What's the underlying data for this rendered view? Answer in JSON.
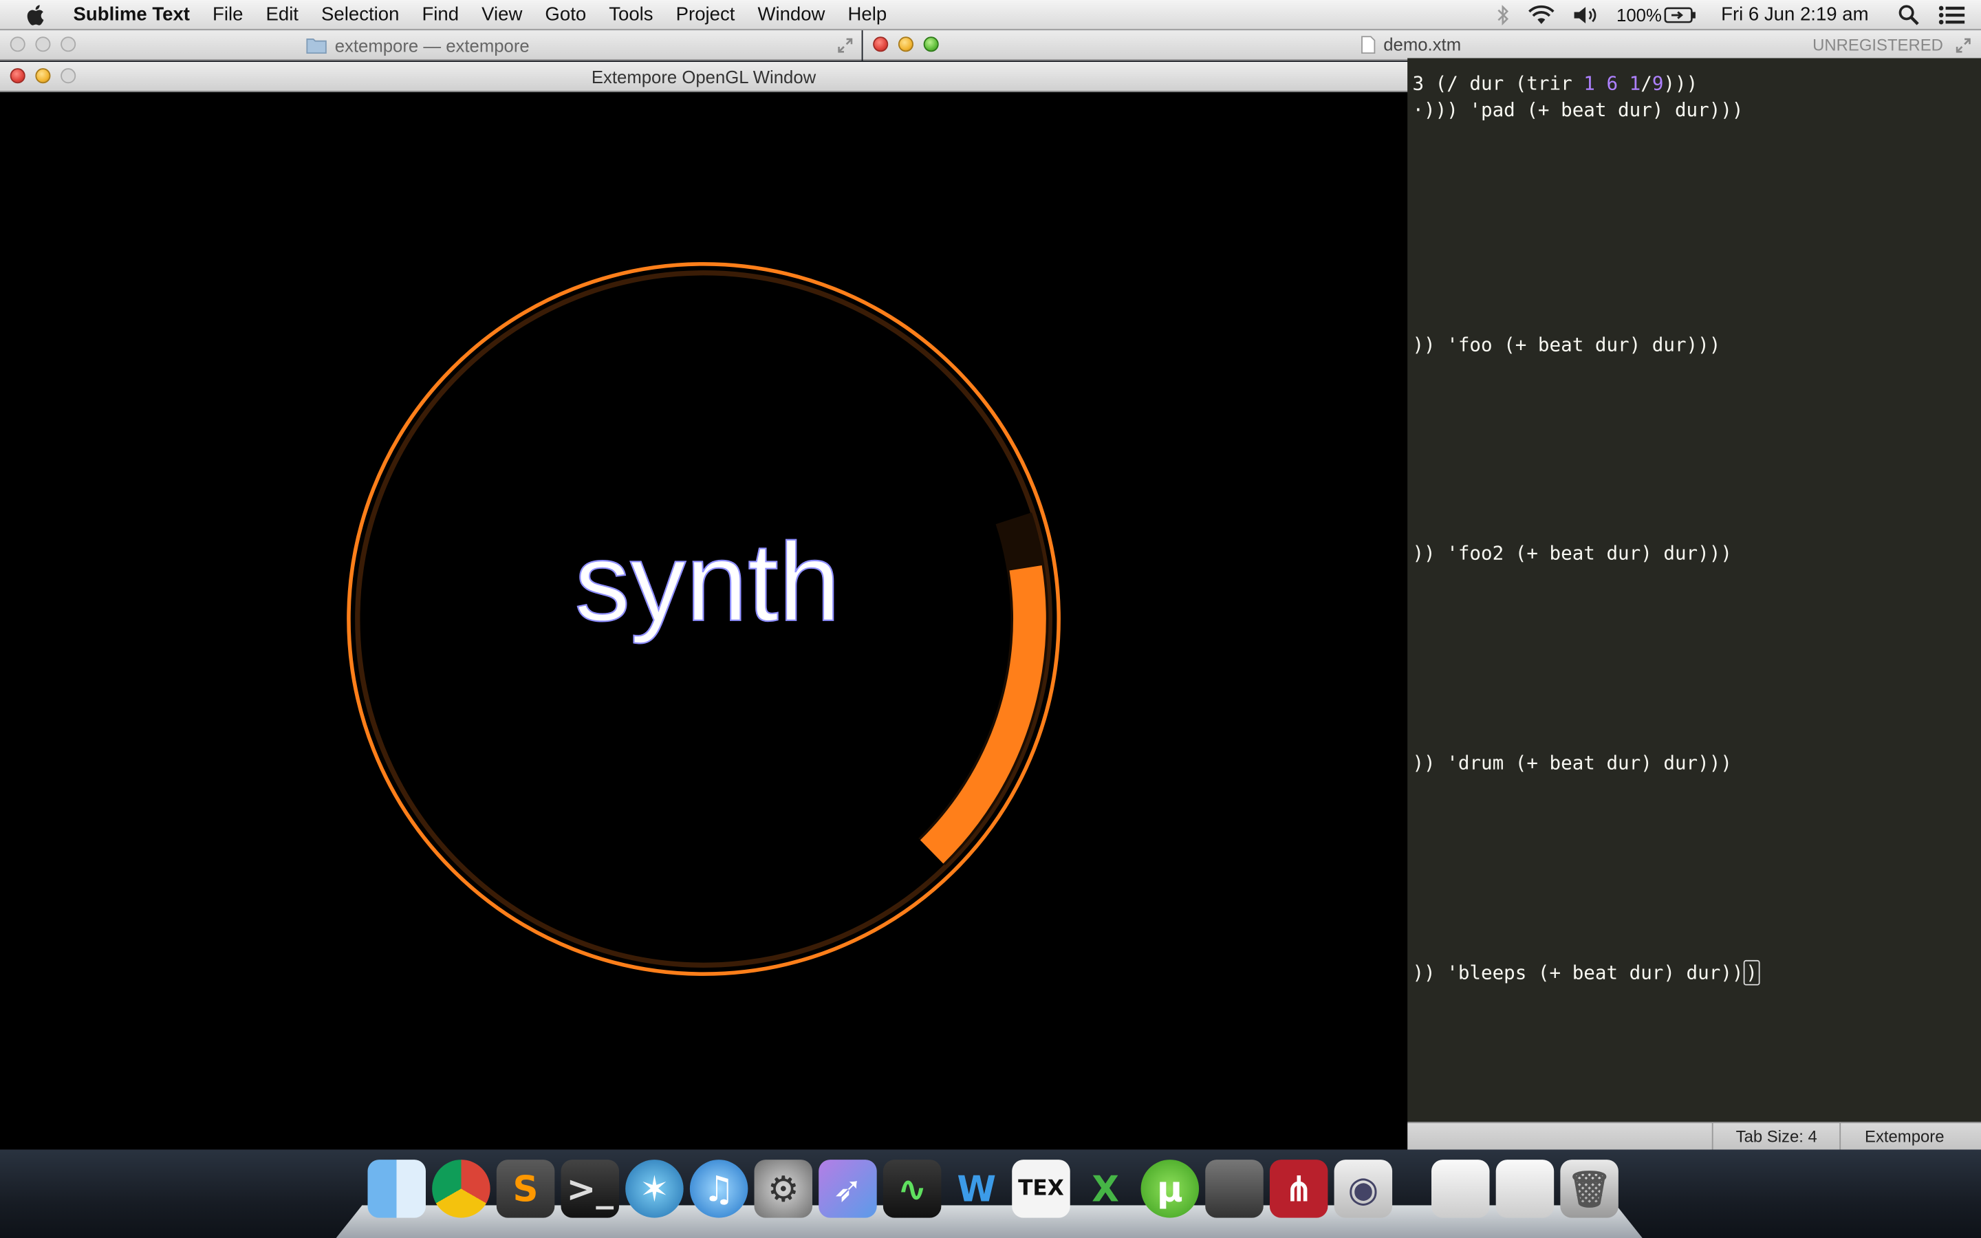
{
  "menubar": {
    "app_name": "Sublime Text",
    "menus": [
      "File",
      "Edit",
      "Selection",
      "Find",
      "View",
      "Goto",
      "Tools",
      "Project",
      "Window",
      "Help"
    ],
    "battery": "100%",
    "clock": "Fri 6 Jun  2:19 am"
  },
  "finder_window": {
    "title": "extempore — extempore"
  },
  "sublime_window": {
    "tab": "demo.xtm",
    "license": "UNREGISTERED"
  },
  "opengl_window": {
    "title": "Extempore OpenGL Window",
    "label": "synth",
    "arc_color": "#ff7f1a",
    "progress": 0.16
  },
  "editor": {
    "lines": [
      {
        "pre": "3 (/ dur (trir ",
        "n1": "1",
        "sp1": " ",
        "n2": "6",
        "sp2": " ",
        "n3": "1",
        "slash": "/",
        "n4": "9",
        "post": ")))"
      },
      {
        "text": "·))) 'pad (+ beat dur) dur)))"
      },
      {
        "text": ")) 'foo (+ beat dur) dur)))"
      },
      {
        "text": ")) 'foo2 (+ beat dur) dur)))"
      },
      {
        "text": ")) 'drum (+ beat dur) dur)))"
      },
      {
        "text": ")) 'bleeps (+ beat dur) dur))",
        "cursor_char": ")"
      }
    ]
  },
  "statusbar": {
    "tab_size": "Tab Size: 4",
    "syntax": "Extempore"
  },
  "dock": {
    "apps": [
      "finder",
      "chrome",
      "sublime-text",
      "terminal",
      "sourcetree",
      "itunes",
      "system-preferences",
      "app-launcher",
      "activity-monitor",
      "word",
      "texshop",
      "excel",
      "utorrent",
      "console",
      "mendeley",
      "preview",
      "documents-stack",
      "downloads-stack",
      "trash"
    ]
  }
}
